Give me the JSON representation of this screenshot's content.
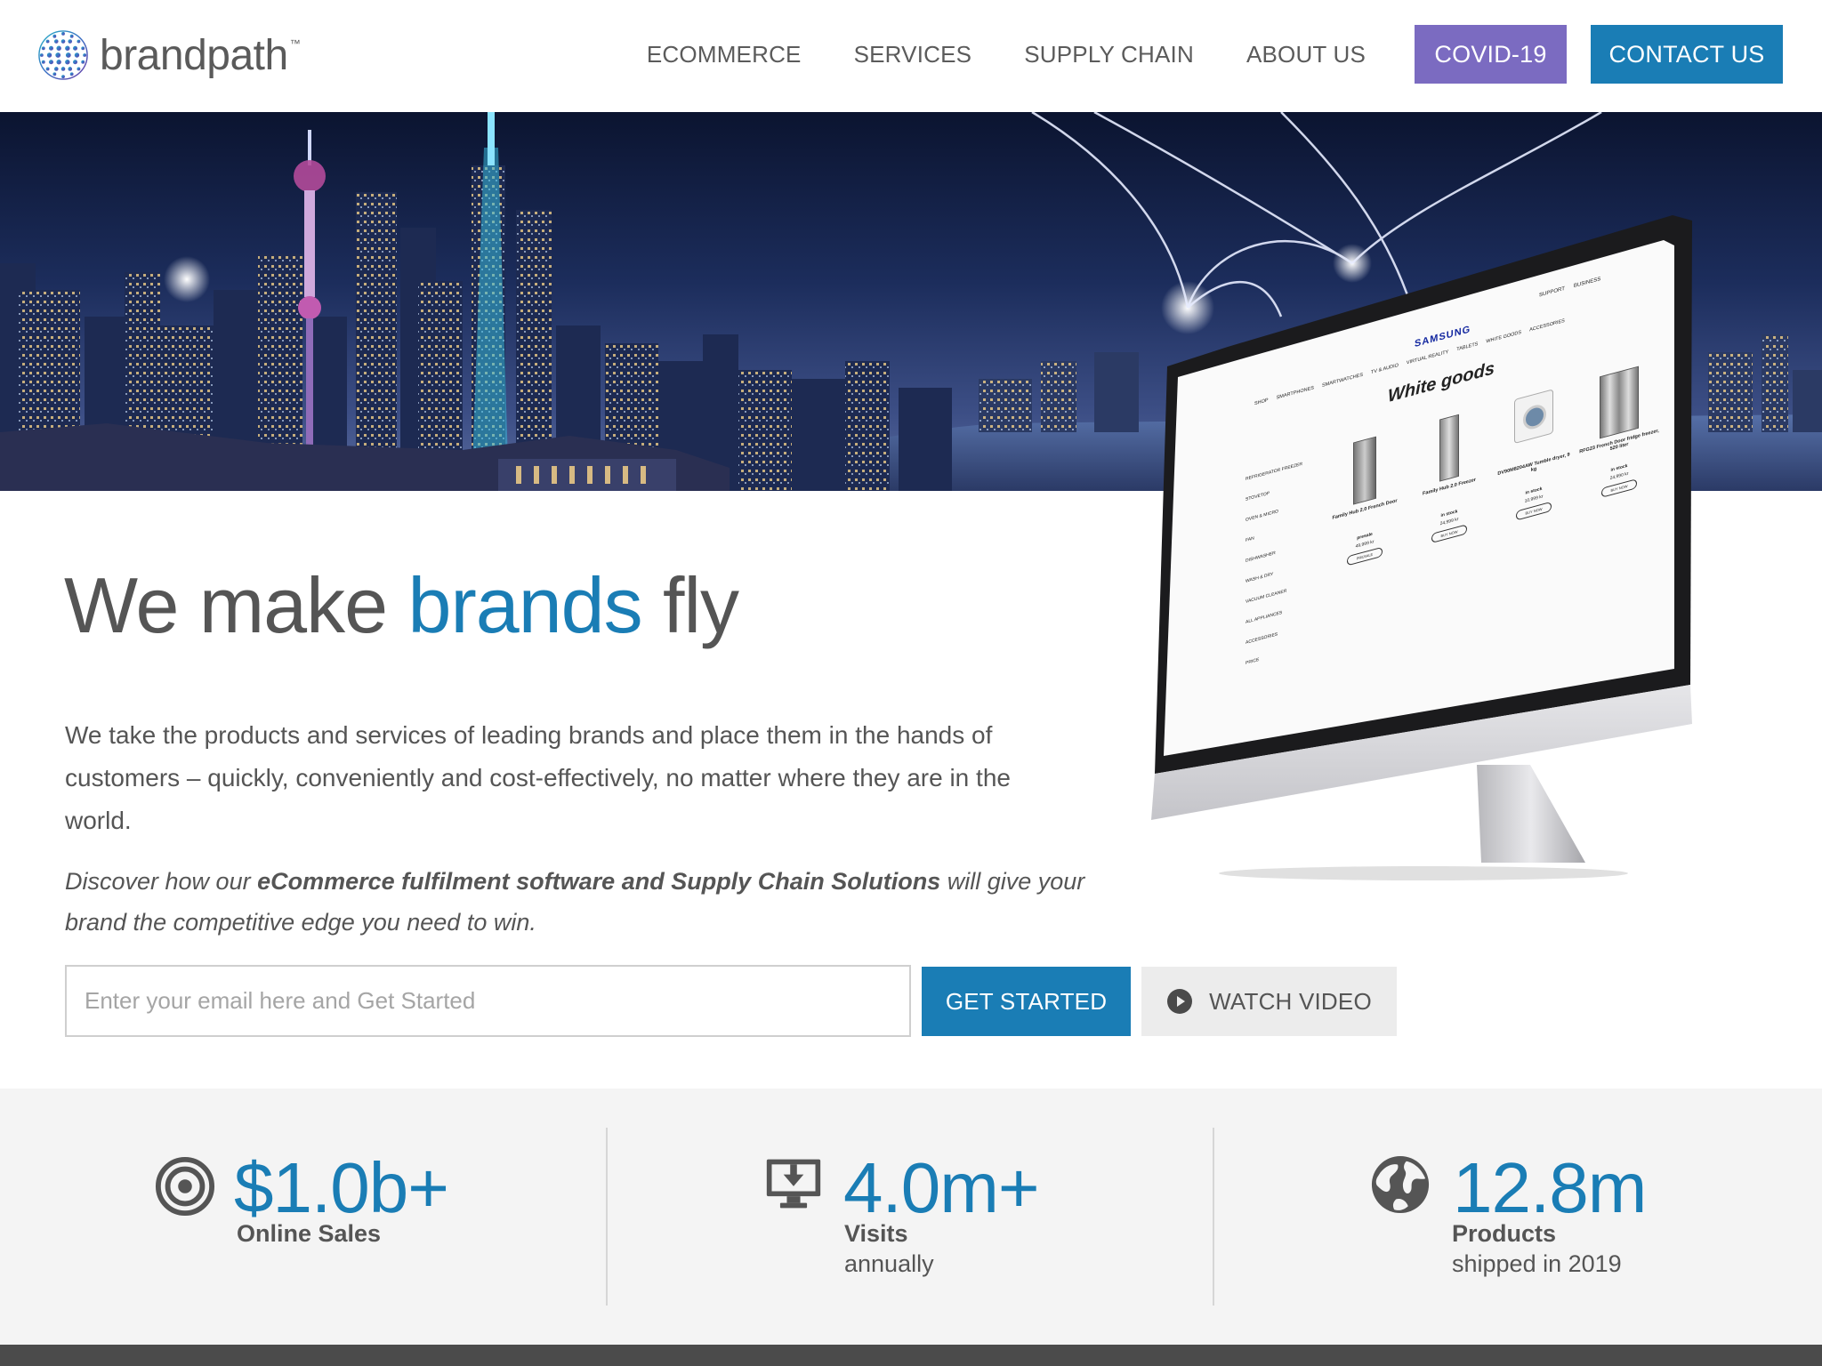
{
  "brand": {
    "name": "brandpath",
    "tm": "™"
  },
  "nav": {
    "links": [
      "ECOMMERCE",
      "SERVICES",
      "SUPPLY CHAIN",
      "ABOUT US"
    ],
    "covid": "COVID-19",
    "contact": "CONTACT US",
    "colors": {
      "covid": "#7b6bc1",
      "contact": "#1a7db5"
    }
  },
  "monitor_screen": {
    "store": "SAMSUNG",
    "page_title": "White goods",
    "top_links": [
      "SUPPORT",
      "BUSINESS"
    ],
    "tabs": [
      "SHOP",
      "SMARTPHONES",
      "SMARTWATCHES",
      "TV & AUDIO",
      "VIRTUAL REALITY",
      "TABLETS",
      "WHITE GOODS",
      "ACCESSORIES"
    ],
    "sidebar": [
      "REFRIGERATOR FREEZER",
      "STOVETOP",
      "OVEN & MICRO",
      "FAN",
      "DISHWASHER",
      "WASH & DRY",
      "VACUUM CLEANER",
      "ALL APPLIANCES",
      "ACCESSORIES",
      "PRICE"
    ],
    "products": [
      {
        "name": "Family Hub 2.0 French Door",
        "price": "49,999 kr",
        "status": "presale",
        "action": "PRESALE"
      },
      {
        "name": "Family Hub 2.0 Freezer",
        "price": "24,999 kr",
        "status": "in stock",
        "action": "BUY NOW"
      },
      {
        "name": "DV90M8204AW Tumble dryer, 9 kg",
        "price": "10,999 kr",
        "status": "in stock",
        "action": "BUY NOW"
      },
      {
        "name": "RFG23 French Door fridge freezer, 520 liter",
        "price": "24,990 kr",
        "status": "in stock",
        "action": "BUY NOW"
      }
    ]
  },
  "hero": {
    "headline_pre": "We make ",
    "headline_accent": "brands",
    "headline_post": " fly",
    "intro": "We take the products and services of leading brands and place them in the hands of customers – quickly, conveniently and cost-effectively, no matter where they are in the world.",
    "discover_pre": "Discover how our ",
    "discover_bold": "eCommerce fulfilment software and Supply Chain Solutions",
    "discover_post": " will give your brand the competitive edge you need to win."
  },
  "cta": {
    "email_placeholder": "Enter your email here and Get Started",
    "get_started": "GET STARTED",
    "watch_video": "WATCH VIDEO"
  },
  "stats": [
    {
      "icon": "target-icon",
      "value": "$1.0b+",
      "label": "Online Sales",
      "sub": ""
    },
    {
      "icon": "monitor-download-icon",
      "value": "4.0m+",
      "label": "Visits",
      "sub": "annually"
    },
    {
      "icon": "globe-icon",
      "value": "12.8m",
      "label": "Products",
      "sub": "shipped in 2019"
    }
  ],
  "accent_color": "#1a7db5"
}
